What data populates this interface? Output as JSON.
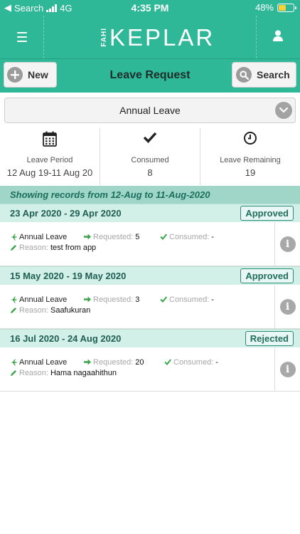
{
  "status_bar": {
    "carrier": "Search",
    "network": "4G",
    "time": "4:35 PM",
    "battery": "48%",
    "battery_level": 0.48
  },
  "header": {
    "logo_prefix": "FAHI",
    "logo_text": "KEPLAR",
    "menu_icon": "hamburger-icon",
    "user_icon": "user-icon"
  },
  "toolbar": {
    "new_label": "New",
    "title": "Leave Request",
    "search_label": "Search"
  },
  "leave_type": {
    "selected": "Annual Leave"
  },
  "stats": [
    {
      "icon": "calendar-icon",
      "label": "Leave Period",
      "value": "12 Aug 19-11 Aug 20"
    },
    {
      "icon": "checkmark-icon",
      "label": "Consumed",
      "value": "8"
    },
    {
      "icon": "clock-icon",
      "label": "Leave Remaining",
      "value": "19"
    }
  ],
  "records_range": "Showing records from 12-Aug to 11-Aug-2020",
  "labels": {
    "requested": "Requested:",
    "consumed": "Consumed:",
    "reason": "Reason:"
  },
  "records": [
    {
      "dates": "23 Apr 2020 - 29 Apr 2020",
      "status": "Approved",
      "type": "Annual Leave",
      "requested": "5",
      "consumed": "-",
      "reason": "test from app"
    },
    {
      "dates": "15 May 2020 - 19 May 2020",
      "status": "Approved",
      "type": "Annual Leave",
      "requested": "3",
      "consumed": "-",
      "reason": "Saafukuran"
    },
    {
      "dates": "16 Jul 2020 - 24 Aug 2020",
      "status": "Rejected",
      "type": "Annual Leave",
      "requested": "20",
      "consumed": "-",
      "reason": "Hama nagaahithun"
    }
  ],
  "colors": {
    "brand": "#2fb898",
    "accent_dark": "#1f6f5d",
    "icon_green": "#3aa64a"
  }
}
